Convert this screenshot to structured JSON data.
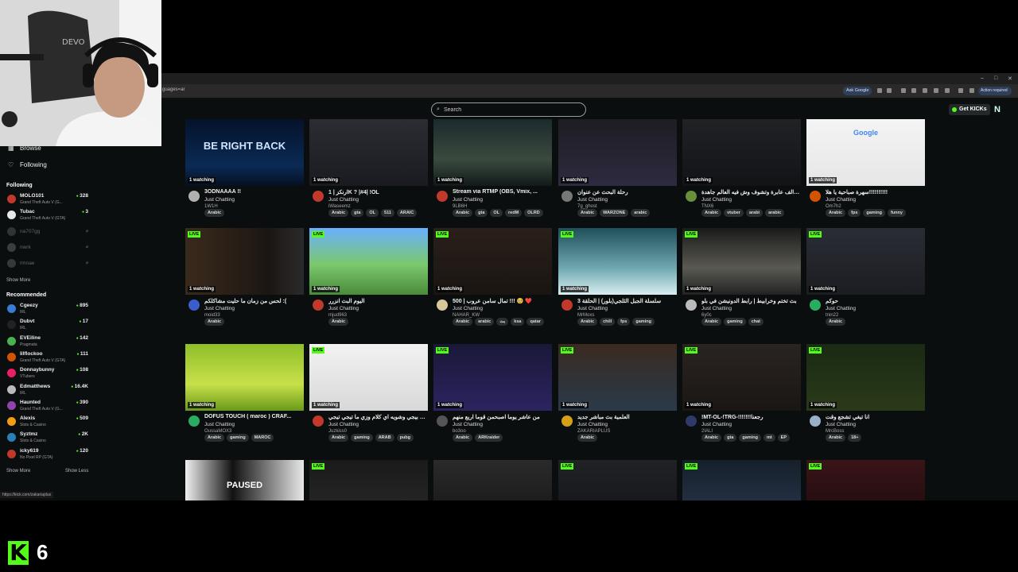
{
  "browser": {
    "url": "guages=ar",
    "ask_google": "Ask Google",
    "action_required": "Action required"
  },
  "header": {
    "search_placeholder": "Search",
    "get_kicks": "Get KICKs"
  },
  "sidebar": {
    "browse": "Browse",
    "following_nav": "Following",
    "following_title": "Following",
    "recommended_title": "Recommended",
    "show_more_1": "Show More",
    "show_more_2": "Show More",
    "show_less": "Show Less",
    "following": [
      {
        "name": "MOLO101",
        "game": "Grand Theft Auto V (G...",
        "viewers": "328",
        "color": "#c0392b",
        "online": true
      },
      {
        "name": "Tubac",
        "game": "Grand Theft Auto V (GTA)",
        "viewers": "3",
        "color": "#e8e8e8",
        "online": true
      },
      {
        "name": "na707gg",
        "game": "",
        "viewers": "⌀",
        "color": "#777777",
        "online": false
      },
      {
        "name": "nwrk",
        "game": "",
        "viewers": "⌀",
        "color": "#999999",
        "online": false
      },
      {
        "name": "rmnae",
        "game": "",
        "viewers": "⌀",
        "color": "#888888",
        "online": false
      }
    ],
    "recommended": [
      {
        "name": "Cgeezy",
        "game": "IRL",
        "viewers": "895",
        "color": "#3a7bd5"
      },
      {
        "name": "Dubvt",
        "game": "IRL",
        "viewers": "17",
        "color": "#222222"
      },
      {
        "name": "EVEiline",
        "game": "Pragmata",
        "viewers": "142",
        "color": "#4caf50"
      },
      {
        "name": "lilflockoo",
        "game": "Grand Theft Auto V (GTA)",
        "viewers": "111",
        "color": "#d35400"
      },
      {
        "name": "Donnaybunny",
        "game": "VTubers",
        "viewers": "108",
        "color": "#e91e63"
      },
      {
        "name": "Edmatthews",
        "game": "IRL",
        "viewers": "16.4K",
        "color": "#bbbbbb"
      },
      {
        "name": "Haunted",
        "game": "Grand Theft Auto V (G...",
        "viewers": "390",
        "color": "#8e44ad"
      },
      {
        "name": "Alexis",
        "game": "Slots & Casino",
        "viewers": "509",
        "color": "#f39c12"
      },
      {
        "name": "Syztmz",
        "game": "Slots & Casino",
        "viewers": "2K",
        "color": "#2980b9"
      },
      {
        "name": "icky619",
        "game": "No Pixel RP (GTA)",
        "viewers": "120",
        "color": "#c0392b"
      }
    ]
  },
  "cards": [
    {
      "title": "3ODNAAAA !!",
      "category": "Just Chatting",
      "user": "1W1H",
      "watching": "1 watching",
      "live": false,
      "tags": [
        "Arabic"
      ],
      "thumb": "linear-gradient(180deg,#05122a,#0a2a55 70%,#061020)",
      "thumb_text": "BE RIGHT BACK",
      "av": "#b0b0b0"
    },
    {
      "title": "ارنكز | 1K ? |#4| !OL",
      "category": "Just Chatting",
      "user": "iWaseemz",
      "watching": "1 watching",
      "live": false,
      "tags": [
        "Arabic",
        "gta",
        "OL",
        "511",
        "ARAIC"
      ],
      "thumb": "linear-gradient(180deg,#2b2d33,#1a1b20)",
      "thumb_text": "",
      "av": "#c0392b"
    },
    {
      "title": "Stream via RTMP (OBS, Vmix, ...",
      "category": "Just Chatting",
      "user": "9LB6H",
      "watching": "1 watching",
      "live": false,
      "tags": [
        "Arabic",
        "gta",
        "OL",
        "redM",
        "OLRD"
      ],
      "thumb": "linear-gradient(180deg,#1b2a2c,#3b4a3e 60%,#121a1a)",
      "thumb_text": "",
      "av": "#c0392b"
    },
    {
      "title": "رحلة البحث عن عنوان",
      "category": "Just Chatting",
      "user": "7g_ghost",
      "watching": "1 watching",
      "live": false,
      "tags": [
        "Arabic",
        "WARZONE",
        "arabic"
      ],
      "thumb": "linear-gradient(180deg,#1d1d22,#2e2a40)",
      "thumb_text": "",
      "av": "#777777"
    },
    {
      "title": "سوالف عابرة وتشوف وش فيه العالم جاهدة",
      "category": "Just Chatting",
      "user": "TNX6",
      "watching": "1 watching",
      "live": false,
      "tags": [
        "Arabic",
        "vtuber",
        "arabi",
        "arabic"
      ],
      "thumb": "linear-gradient(180deg,#202226,#121316)",
      "thumb_text": "",
      "av": "#6a8f3a"
    },
    {
      "title": "سهرة صباحية يا هلا!!!!!!!!!!",
      "category": "Just Chatting",
      "user": "Om7h2",
      "watching": "1 watching",
      "live": false,
      "tags": [
        "Arabic",
        "fps",
        "gaming",
        "funny"
      ],
      "thumb": "linear-gradient(180deg,#f4f4f4,#e6e6e6)",
      "thumb_text": "Google",
      "av": "#d35400"
    },
    {
      "title": "لحس من زمان ما حليت مشاكلكم :(",
      "category": "Just Chatting",
      "user": "moid33",
      "watching": "1 watching",
      "live": true,
      "tags": [
        "Arabic"
      ],
      "thumb": "linear-gradient(90deg,#3a2a1c,#1c1612 70%,#2b2b2b)",
      "thumb_text": "",
      "av": "#3a5fcd"
    },
    {
      "title": "اليوم البث انزرر",
      "category": "Just Chatting",
      "user": "mjud963",
      "watching": "1 watching",
      "live": true,
      "tags": [
        "Arabic"
      ],
      "thumb": "linear-gradient(180deg,#6ab0ff,#7bc86c 55%,#4a8a3a)",
      "thumb_text": "",
      "av": "#c0392b"
    },
    {
      "title": "تمال سامن عروب | 500 !!! 🥹 ❤️",
      "category": "Just Chatting",
      "user": "NAHAR_KW",
      "watching": "1 watching",
      "live": true,
      "tags": [
        "Arabic",
        "arabic",
        "بث",
        "ksa",
        "qatar"
      ],
      "thumb": "linear-gradient(180deg,#2a1f1a,#1a1512)",
      "thumb_text": "",
      "av": "#d8c89a"
    },
    {
      "title": "سلسلة الجبل الثلجي(بلور) | الحلقة 3",
      "category": "Just Chatting",
      "user": "MrMoxs",
      "watching": "1 watching",
      "live": true,
      "tags": [
        "Arabic",
        "chill",
        "fps",
        "gaming"
      ],
      "thumb": "linear-gradient(180deg,#1f4f5a,#6fa8b0 60%,#d8eef0)",
      "thumb_text": "",
      "av": "#c0392b"
    },
    {
      "title": "بث تختم وخرابيط | رابط الدونيشن في بلو",
      "category": "Just Chatting",
      "user": "6y0c",
      "watching": "1 watching",
      "live": true,
      "tags": [
        "Arabic",
        "gaming",
        "chat"
      ],
      "thumb": "linear-gradient(180deg,#1a1a1a,#5a5a52 60%,#222)",
      "thumb_text": "",
      "av": "#bbbbbb"
    },
    {
      "title": "حوكم",
      "category": "Just Chatting",
      "user": "tnin22",
      "watching": "1 watching",
      "live": true,
      "tags": [
        "Arabic"
      ],
      "thumb": "linear-gradient(180deg,#2a2d34,#1b1d22)",
      "thumb_text": "",
      "av": "#27ae60"
    },
    {
      "title": "DOFUS TOUCH ( maroc ) CRAF...",
      "category": "Just Chatting",
      "user": "OussaMOX3",
      "watching": "1 watching",
      "live": false,
      "tags": [
        "Arabic",
        "gaming",
        "MAROC"
      ],
      "thumb": "linear-gradient(180deg,#8fbf2a,#c8e04a 60%,#6a9a1a)",
      "thumb_text": "",
      "av": "#27ae60"
    },
    {
      "title": "تيجي بيجي وشويه اي كلام وزي ما تيجي تيجي",
      "category": "Just Chatting",
      "user": "Juzkiss0",
      "watching": "1 watching",
      "live": true,
      "tags": [
        "Arabic",
        "gaming",
        "ARAB",
        "pubg"
      ],
      "thumb": "linear-gradient(180deg,#f2f2f2,#d8d8d8)",
      "thumb_text": "",
      "av": "#c0392b"
    },
    {
      "title": "من عاشر يوما اصبحمن قوما اربع منهم",
      "category": "Just Chatting",
      "user": "bo3oo",
      "watching": "1 watching",
      "live": true,
      "tags": [
        "Arabic",
        "ARKraider"
      ],
      "thumb": "linear-gradient(180deg,#1a1838,#2b2460)",
      "thumb_text": "",
      "av": "#555555"
    },
    {
      "title": "العلمية بث مباشر جديد",
      "category": "Just Chatting",
      "user": "ZAKARIAPLUS",
      "watching": "1 watching",
      "live": true,
      "tags": [
        "Arabic"
      ],
      "thumb": "linear-gradient(180deg,#3a2a20,#2a3a4a)",
      "thumb_text": "",
      "av": "#d4a017"
    },
    {
      "title": "!MT-OL-!TRG-!!!!!!!رجعنا",
      "category": "Just Chatting",
      "user": "2IALI",
      "watching": "1 watching",
      "live": true,
      "tags": [
        "Arabic",
        "gta",
        "gaming",
        "mt",
        "EP"
      ],
      "thumb": "linear-gradient(180deg,#2a2420,#1a1614)",
      "thumb_text": "",
      "av": "#2d3a6a"
    },
    {
      "title": "انا تيغي تشجع وقت",
      "category": "Just Chatting",
      "user": "MrcBoss",
      "watching": "1 watching",
      "live": true,
      "tags": [
        "Arabic",
        "18+"
      ],
      "thumb": "linear-gradient(180deg,#1a2a14,#2a3a18)",
      "thumb_text": "",
      "av": "#9ab0c8"
    },
    {
      "title": "",
      "category": "",
      "user": "",
      "watching": "",
      "live": false,
      "tags": [],
      "thumb": "linear-gradient(90deg,#f0f0f0,#111 40%,#e8e8e8)",
      "thumb_text": "PAUSED",
      "av": "#000000"
    },
    {
      "title": "",
      "category": "",
      "user": "",
      "watching": "",
      "live": true,
      "tags": [],
      "thumb": "linear-gradient(180deg,#1a1a1a,#2a2a2a)",
      "thumb_text": "",
      "av": "#000000"
    },
    {
      "title": "",
      "category": "",
      "user": "",
      "watching": "",
      "live": false,
      "tags": [],
      "thumb": "linear-gradient(180deg,#2a2a2a,#151515)",
      "thumb_text": "",
      "av": "#000000"
    },
    {
      "title": "",
      "category": "",
      "user": "",
      "watching": "",
      "live": true,
      "tags": [],
      "thumb": "linear-gradient(180deg,#202226,#121316)",
      "thumb_text": "",
      "av": "#000000"
    },
    {
      "title": "",
      "category": "",
      "user": "",
      "watching": "",
      "live": true,
      "tags": [],
      "thumb": "linear-gradient(180deg,#16202a,#2a3850)",
      "thumb_text": "",
      "av": "#000000"
    },
    {
      "title": "",
      "category": "",
      "user": "",
      "watching": "",
      "live": true,
      "tags": [],
      "thumb": "linear-gradient(180deg,#3a1418,#1a0a0c)",
      "thumb_text": "",
      "av": "#000000"
    }
  ],
  "status_url": "https://kick.com/zakariaplus",
  "brand": {
    "logo": "K",
    "number": "6"
  },
  "colors": {
    "accent": "#53fc18",
    "background": "#0b0e0f"
  }
}
